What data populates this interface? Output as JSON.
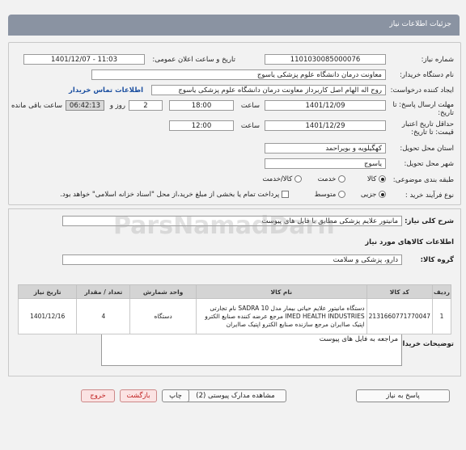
{
  "header": {
    "title": "جزئیات اطلاعات نیاز"
  },
  "form": {
    "need_number_label": "شماره نیاز:",
    "need_number": "1101030085000076",
    "announce_label": "تاریخ و ساعت اعلان عمومی:",
    "announce_value": "1401/12/07 - 11:03",
    "buyer_label": "نام دستگاه خریدار:",
    "buyer_value": "معاونت درمان دانشگاه علوم پزشکی یاسوج",
    "creator_label": "ایجاد کننده درخواست:",
    "creator_value": "روح اله الهام اصل کاربرداز معاونت درمان دانشگاه علوم پزشکی یاسوج",
    "contact_link": "اطلاعات تماس خریدار",
    "deadline_label": "مهلت ارسال پاسخ: تا تاریخ:",
    "deadline_date": "1401/12/09",
    "time_label": "ساعت",
    "deadline_time": "18:00",
    "days_value": "2",
    "days_label": "روز و",
    "remaining_time": "06:42:13",
    "remaining_label": "ساعت باقی مانده",
    "min_validity_label": "حداقل تاریخ اعتبار قیمت: تا تاریخ:",
    "validity_date": "1401/12/29",
    "validity_time_label": "ساعت",
    "validity_time": "12:00",
    "province_label": "استان محل تحویل:",
    "province_value": "کهگیلویه و بویراحمد",
    "city_label": "شهر محل تحویل:",
    "city_value": "یاسوج",
    "category_label": "طبقه بندی موضوعی:",
    "category_options": [
      "کالا",
      "خدمت",
      "کالا/خدمت"
    ],
    "process_label": "نوع فرآیند خرید :",
    "process_options": [
      "جزیی",
      "متوسط"
    ],
    "payment_note": "پرداخت تمام یا بخشی از مبلغ خرید،از محل \"اسناد خزانه اسلامی\" خواهد بود."
  },
  "summary": {
    "label": "شرح کلی نیاز:",
    "value": "مانیتور علایم پزشکی مطابق با فایل های پیوست"
  },
  "goods": {
    "section_title": "اطلاعات کالاهای مورد نیاز",
    "group_label": "گروه کالا:",
    "group_value": "دارو، پزشکی و سلامت",
    "columns": [
      "ردیف",
      "کد کالا",
      "نام کالا",
      "واحد شمارش",
      "تعداد / مقدار",
      "تاریخ نیاز"
    ],
    "rows": [
      {
        "index": "1",
        "code": "2131660771770047",
        "name": "دستگاه مانیتور علایم حیاتی بیمار مدل SADRA 10 نام تجارتی IMED HEALTH INDUSTRIES مرجع عرضه کننده صنایع الکترو اپتیک صاایران مرجع سازنده صنایع الکترو اپتیک صاایران",
        "unit": "دستگاه",
        "qty": "4",
        "date": "1401/12/16"
      }
    ]
  },
  "buyer_notes": {
    "label": "توضیحات خریدار:",
    "value": "مراجعه به فایل های پیوست"
  },
  "buttons": {
    "reply": "پاسخ به نیاز",
    "attachments": "مشاهده مدارک پیوستی (2)",
    "print": "چاپ",
    "back": "بازگشت",
    "exit": "خروج"
  },
  "watermark": "ParsNamadDarn"
}
